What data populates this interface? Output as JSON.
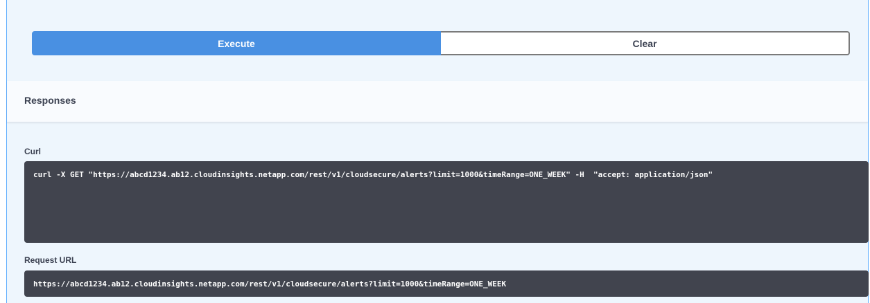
{
  "actions": {
    "execute_label": "Execute",
    "clear_label": "Clear"
  },
  "responses": {
    "title": "Responses"
  },
  "curl": {
    "label": "Curl",
    "command": "curl -X GET \"https://abcd1234.ab12.cloudinsights.netapp.com/rest/v1/cloudsecure/alerts?limit=1000&timeRange=ONE_WEEK\" -H  \"accept: application/json\""
  },
  "request_url": {
    "label": "Request URL",
    "value": "https://abcd1234.ab12.cloudinsights.netapp.com/rest/v1/cloudsecure/alerts?limit=1000&timeRange=ONE_WEEK"
  },
  "colors": {
    "accent": "#4990e2",
    "panel_bg": "#eef6fd",
    "code_bg": "#41444e"
  }
}
